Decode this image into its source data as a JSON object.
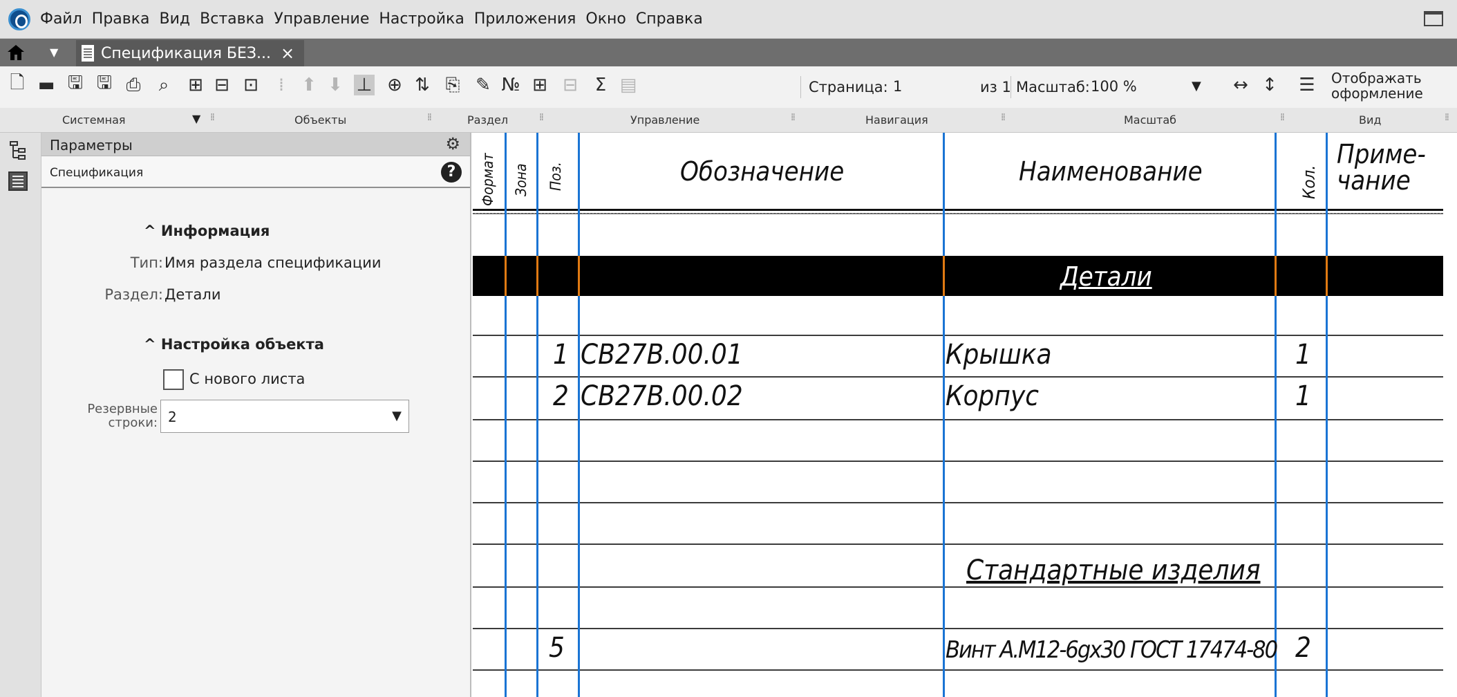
{
  "menu": {
    "items": [
      "Файл",
      "Правка",
      "Вид",
      "Вставка",
      "Управление",
      "Настройка",
      "Приложения",
      "Окно",
      "Справка"
    ]
  },
  "tab": {
    "title": "Спецификация БЕЗ...",
    "close": "×"
  },
  "toolbar": {
    "page_label": "Страница:",
    "page_value": "1",
    "page_total": "из 1",
    "scale_label": "Масштаб:",
    "scale_value": "100 %",
    "show_frame": "Отображать оформление"
  },
  "panels": {
    "system": "Системная",
    "objects": "Объекты",
    "section": "Раздел",
    "control": "Управление",
    "navigation": "Навигация",
    "scale": "Масштаб",
    "view": "Вид"
  },
  "params": {
    "title": "Параметры",
    "subtitle": "Спецификация",
    "info_heading": "Информация",
    "type_label": "Тип:",
    "type_value": "Имя раздела спецификации",
    "section_label": "Раздел:",
    "section_value": "Детали",
    "setup_heading": "Настройка объекта",
    "new_sheet_label": "С нового листа",
    "new_sheet_checked": false,
    "reserve_label_1": "Резервные",
    "reserve_label_2": "строки:",
    "reserve_value": "2"
  },
  "sheet": {
    "headers": {
      "format": "Формат",
      "zone": "Зона",
      "pos": "Поз.",
      "designation": "Обозначение",
      "name": "Наименование",
      "qty": "Кол.",
      "note_1": "Приме-",
      "note_2": "чание"
    },
    "section_details": "Детали",
    "rows": [
      {
        "pos": "1",
        "designation": "СВ27В.00.01",
        "name": "Крышка",
        "qty": "1"
      },
      {
        "pos": "2",
        "designation": "СВ27В.00.02",
        "name": "Корпус",
        "qty": "1"
      }
    ],
    "section_standard": "Стандартные изделия",
    "standard_rows": [
      {
        "pos": "5",
        "name": "Винт А.М12-6gх30 ГОСТ 17474-80",
        "qty": "2"
      }
    ]
  },
  "colors": {
    "column_lines": "#1a74d4",
    "highlight_lines": "#e07a12",
    "annotation": "#e81010"
  },
  "icons": [
    "app-logo",
    "home-icon",
    "document-icon",
    "new-file-icon",
    "open-folder-icon",
    "save-icon",
    "save-all-icon",
    "print-icon",
    "preview-icon",
    "gear-icon",
    "help-icon",
    "checkbox-icon",
    "chevron-down-icon",
    "tree-icon",
    "parameters-icon",
    "maximize-icon"
  ]
}
